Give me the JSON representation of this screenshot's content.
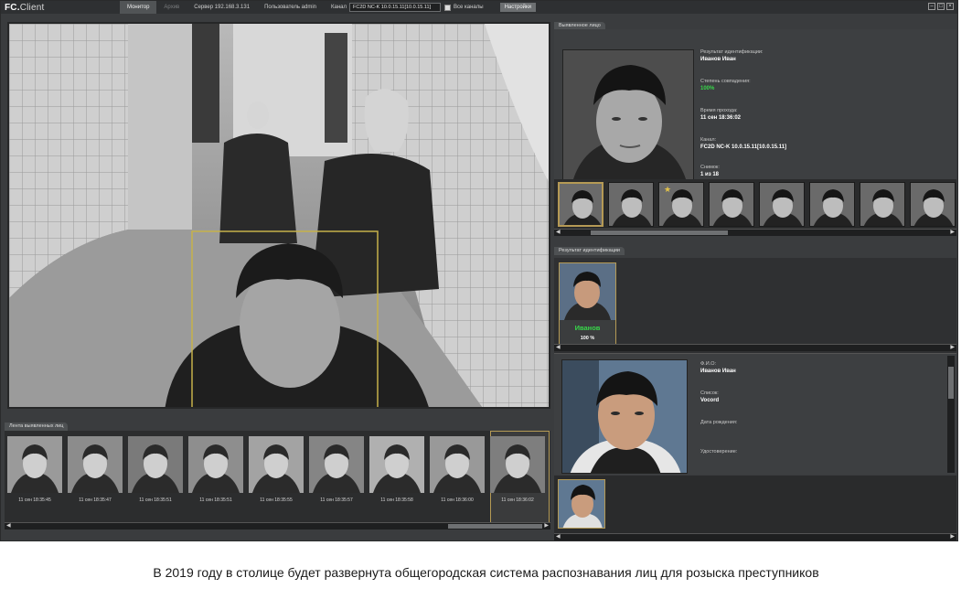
{
  "app": {
    "logo_main": "FC.",
    "logo_sub": "Client"
  },
  "topbar": {
    "tabs": [
      "Монитор",
      "Архив"
    ],
    "server": "Сервер 192.168.3.131",
    "user": "Пользователь admin",
    "channel_label": "Канал",
    "channel_value": "FC2D NC-K 10.0.15.11[10.0.15.11]",
    "all_channels": "Все каналы",
    "settings": "Настройки"
  },
  "strip": {
    "title": "Лента выявленных лиц",
    "times": [
      "11 сен 18:35:45",
      "11 сен 18:35:47",
      "11 сен 18:35:51",
      "11 сен 18:35:51",
      "11 сен 18:35:55",
      "11 сен 18:35:57",
      "11 сен 18:35:58",
      "11 сен 18:36:00",
      "11 сен 18:36:02"
    ]
  },
  "detected": {
    "title": "Выявленное лицо",
    "result_label": "Результат идентификации:",
    "result_value": "Иванов Иван",
    "match_label": "Степень совпадения:",
    "match_value": "100%",
    "time_label": "Время прохода:",
    "time_value": "11 сен 18:36:02",
    "channel_label": "Канал:",
    "channel_value": "FC2D NC-K 10.0.15.11[10.0.15.11]",
    "snapshot_label": "Снимок:",
    "snapshot_value": "1 из 18"
  },
  "identification": {
    "title": "Результат идентификации",
    "card_name": "Иванов",
    "card_pct": "100 %"
  },
  "person": {
    "fio_label": "Ф.И.О:",
    "fio_value": "Иванов Иван",
    "list_label": "Список:",
    "list_value": "Vocord",
    "birth_label": "Дата рождения:",
    "id_label": "Удостоверение:"
  },
  "caption": "В 2019 году в столице будет развернута общегородская система распознавания лиц для розыска преступников",
  "colors": {
    "accent": "#b59a55",
    "match_green": "#38d64a",
    "background": "#3a3c3e"
  }
}
